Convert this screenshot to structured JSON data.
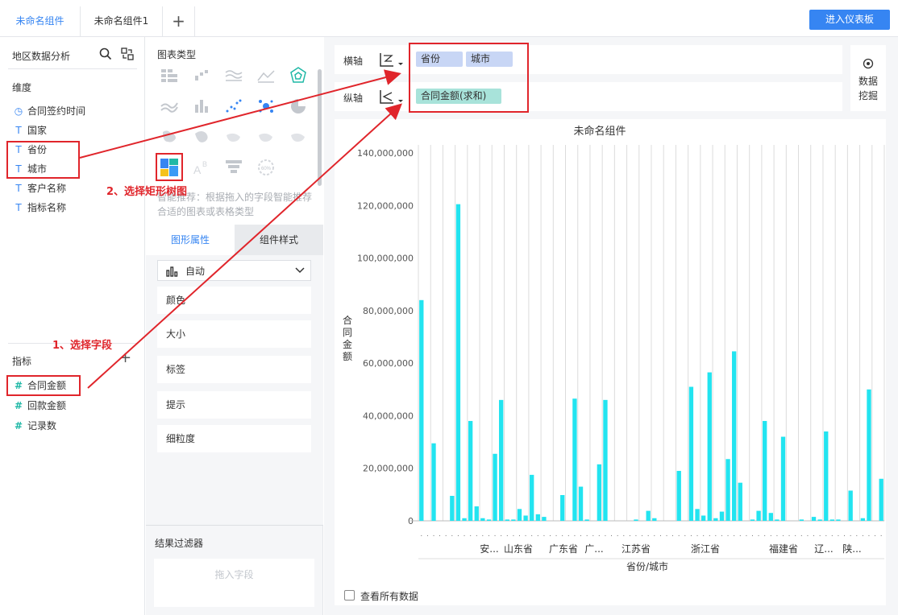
{
  "tabs": [
    {
      "label": "未命名组件"
    },
    {
      "label": "未命名组件1"
    },
    {
      "label": "+"
    }
  ],
  "enter_dashboard": "进入仪表板",
  "left": {
    "title": "地区数据分析",
    "dimension_header": "维度",
    "dimensions": [
      "合同签约时间",
      "国家",
      "省份",
      "城市",
      "客户名称",
      "指标名称"
    ],
    "metric_header": "指标",
    "metrics": [
      "合同金额",
      "回款金额",
      "记录数"
    ]
  },
  "mid": {
    "chart_type_header": "图表类型",
    "smart_tip": "智能推荐：根据拖入的字段智能推荐合适的图表或表格类型",
    "tab_graph": "图形属性",
    "tab_style": "组件样式",
    "auto_label": "自动",
    "props": [
      "颜色",
      "大小",
      "标签",
      "提示",
      "细粒度"
    ],
    "filter_header": "结果过滤器",
    "filter_placeholder": "拖入字段"
  },
  "right": {
    "x_label": "横轴",
    "y_label": "纵轴",
    "x_pills": [
      "省份",
      "城市"
    ],
    "y_pill": "合同金额(求和)",
    "mining": [
      "数据",
      "挖掘"
    ],
    "show_all": "查看所有数据"
  },
  "annotations": {
    "step1": "1、选择字段",
    "step2": "2、选择矩形树图"
  },
  "colors": {
    "accent": "#3685f2",
    "bar": "#22e4f0",
    "annotation": "#e0252b"
  },
  "chart_data": {
    "type": "bar",
    "title": "未命名组件",
    "ylabel": "合同金额",
    "xlabel": "省份/城市",
    "ylim": [
      0,
      140000000
    ],
    "yticks": [
      "140,000,000",
      "120,000,000",
      "100,000,000",
      "80,000,000",
      "60,000,000",
      "40,000,000",
      "20,000,000",
      "0"
    ],
    "group_labels": [
      "安...",
      "山东省",
      "广东省",
      "广...",
      "江苏省",
      "浙江省",
      "福建省",
      "辽...",
      "陕..."
    ],
    "values": [
      84000000,
      0,
      29500000,
      0,
      0,
      9500000,
      120500000,
      1000000,
      38000000,
      5500000,
      1000000,
      500000,
      25500000,
      46000000,
      500000,
      500000,
      4500000,
      2000000,
      17500000,
      2500000,
      1500000,
      0,
      0,
      9800000,
      0,
      46500000,
      13000000,
      500000,
      0,
      21500000,
      46000000,
      0,
      0,
      0,
      0,
      500000,
      0,
      3800000,
      1000000,
      0,
      0,
      0,
      19000000,
      0,
      51000000,
      4500000,
      2000000,
      56500000,
      1000000,
      3500000,
      23500000,
      64500000,
      14500000,
      0,
      500000,
      3800000,
      38000000,
      3000000,
      500000,
      32000000,
      0,
      0,
      500000,
      0,
      1500000,
      500000,
      34000000,
      500000,
      500000,
      0,
      11500000,
      0,
      1000000,
      50000000,
      0,
      16000000
    ]
  }
}
